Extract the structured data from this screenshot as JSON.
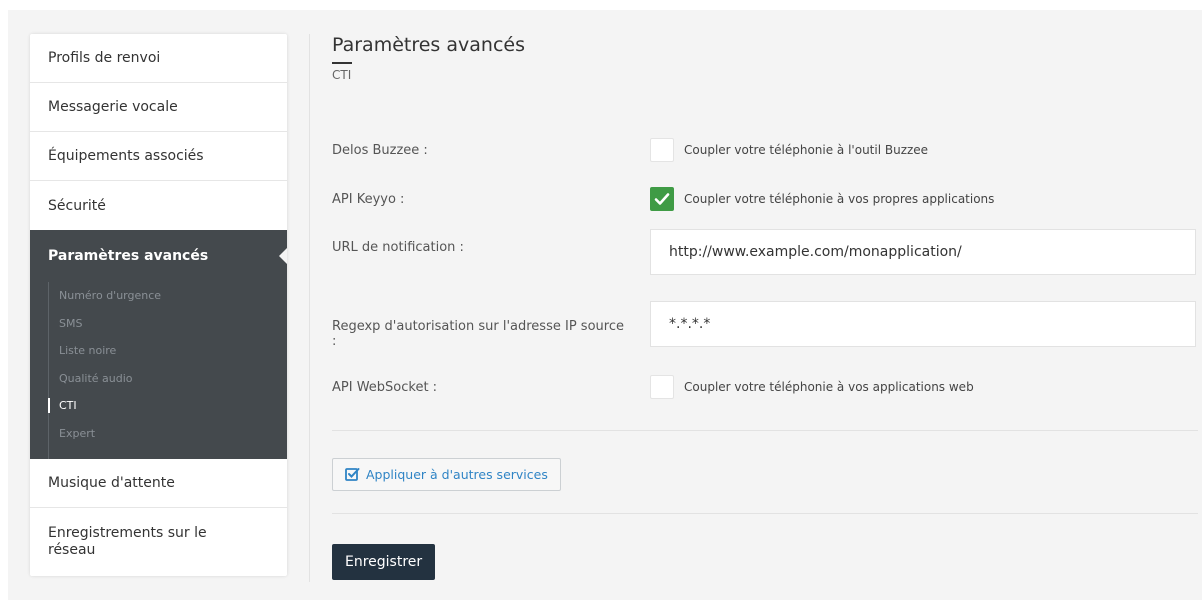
{
  "sidebar": {
    "items_top": [
      {
        "label": "Profils de renvoi"
      },
      {
        "label": "Messagerie vocale"
      },
      {
        "label": "Équipements associés"
      },
      {
        "label": "Sécurité"
      }
    ],
    "active": {
      "label": "Paramètres avancés",
      "sub_items": [
        {
          "label": "Numéro d'urgence"
        },
        {
          "label": "SMS"
        },
        {
          "label": "Liste noire"
        },
        {
          "label": "Qualité audio"
        },
        {
          "label": "CTI"
        },
        {
          "label": "Expert"
        }
      ]
    },
    "items_bottom": [
      {
        "label": "Musique d'attente"
      },
      {
        "label": "Enregistrements sur le réseau"
      }
    ]
  },
  "main": {
    "title": "Paramètres avancés",
    "subtitle": "CTI",
    "fields": {
      "delos": {
        "label": "Delos Buzzee :",
        "checkbox_label": "Coupler votre téléphonie à l'outil Buzzee",
        "checked": false
      },
      "api_keyyo": {
        "label": "API Keyyo :",
        "checkbox_label": "Coupler votre téléphonie à vos propres applications",
        "checked": true
      },
      "url_notification": {
        "label": "URL de notification :",
        "value": "http://www.example.com/monapplication/"
      },
      "regexp": {
        "label": "Regexp d'autorisation sur l'adresse IP source :",
        "value": "*.*.*.*"
      },
      "websocket": {
        "label": "API WebSocket :",
        "checkbox_label": "Coupler votre téléphonie à vos applications web",
        "checked": false
      }
    },
    "apply_button": "Appliquer à d'autres services",
    "save_button": "Enregistrer"
  },
  "colors": {
    "sidebar_active_bg": "#44494d",
    "checkbox_checked": "#3f9b45",
    "link_blue": "#2f84c5",
    "save_button_bg": "#233240"
  }
}
